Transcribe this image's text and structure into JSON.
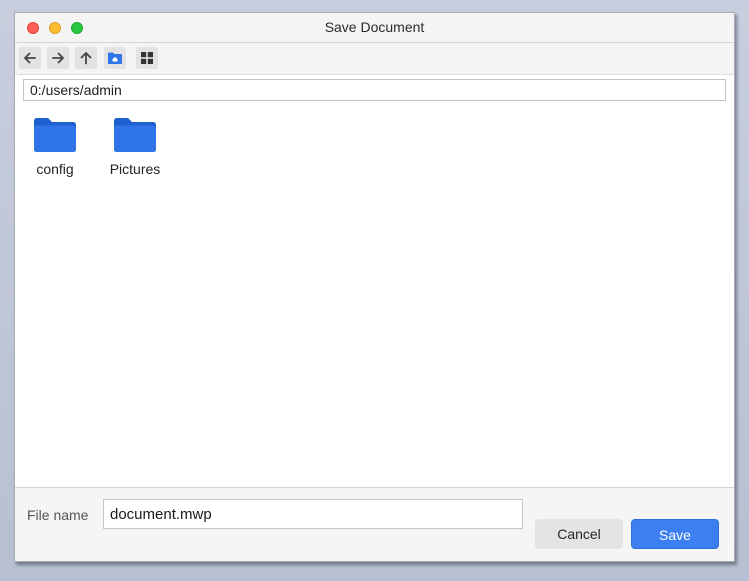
{
  "window": {
    "title": "Save Document"
  },
  "toolbar": {
    "buttons": [
      {
        "icon": "back-arrow-icon"
      },
      {
        "icon": "forward-arrow-icon"
      },
      {
        "icon": "up-arrow-icon"
      },
      {
        "icon": "home-folder-icon"
      },
      {
        "icon": "grid-view-icon"
      }
    ]
  },
  "path": {
    "value": "0:/users/admin"
  },
  "files": [
    {
      "name": "config",
      "type": "folder"
    },
    {
      "name": "Pictures",
      "type": "folder"
    }
  ],
  "footer": {
    "file_name_label": "File name",
    "file_name_value": "document.mwp",
    "cancel_label": "Cancel",
    "save_label": "Save"
  },
  "colors": {
    "accent": "#3b7ff0",
    "folder": "#2f74e8",
    "close": "#fe5e57",
    "minimize": "#febc2e",
    "maximize": "#28c840"
  }
}
